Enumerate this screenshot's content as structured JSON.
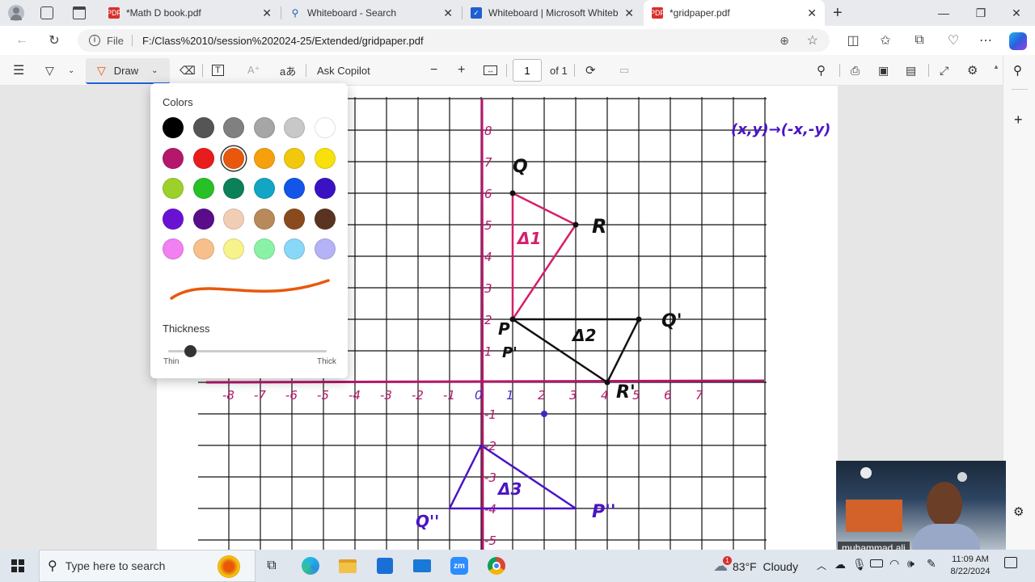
{
  "tabs": [
    {
      "title": "*Math D book.pdf",
      "icon": "pdf-icon"
    },
    {
      "title": "Whiteboard - Search",
      "icon": "search-icon"
    },
    {
      "title": "Whiteboard | Microsoft Whitebo",
      "icon": "whiteboard-icon"
    },
    {
      "title": "*gridpaper.pdf",
      "icon": "pdf-icon"
    }
  ],
  "address": {
    "prefix": "File",
    "url": "F:/Class%2010/session%202024-25/Extended/gridpaper.pdf"
  },
  "pdf_toolbar": {
    "draw_label": "Draw",
    "copilot_label": "Ask Copilot",
    "page_value": "1",
    "page_of": "of 1",
    "text_icon_label": "aあ"
  },
  "draw_popup": {
    "colors_heading": "Colors",
    "thickness_heading": "Thickness",
    "thin_label": "Thin",
    "thick_label": "Thick",
    "selected_color": "#e8580c",
    "thickness_fraction": 0.14,
    "swatches": [
      "#000000",
      "#555555",
      "#808080",
      "#a6a6a6",
      "#c8c8c8",
      "#ffffff",
      "#b5176b",
      "#e81c1c",
      "#e8580c",
      "#f5a00c",
      "#f2c80c",
      "#f7e00c",
      "#9bd12a",
      "#27c027",
      "#0c8059",
      "#12a6c4",
      "#1255e8",
      "#3a12c4",
      "#6a12d4",
      "#5a0c8a",
      "#f2cdb6",
      "#b88a5a",
      "#8a4a1e",
      "#5a3420",
      "#f280f2",
      "#f7c08a",
      "#f7f28a",
      "#8af2a6",
      "#8ad8f7",
      "#b6b2f7"
    ]
  },
  "graph": {
    "x_labels": [
      "-8",
      "-7",
      "-6",
      "-5",
      "-4",
      "-3",
      "-2",
      "-1",
      "0",
      "1",
      "2",
      "3",
      "4",
      "5",
      "6",
      "7"
    ],
    "y_pos_labels": [
      "1",
      "2",
      "3",
      "4",
      "5",
      "6",
      "7",
      "8"
    ],
    "y_neg_labels": [
      "-1",
      "-2",
      "-3",
      "-4",
      "-5"
    ],
    "rule_text": "(x,y)→(-x,-y)",
    "annotations": {
      "Q": "Q",
      "R": "R",
      "P": "P",
      "P_prime": "P'",
      "Q_prime": "Q'",
      "R_prime": "R'",
      "Q2": "Q''",
      "P2": "P''",
      "t1": "Δ1",
      "t2": "Δ2",
      "t3": "Δ3"
    }
  },
  "video": {
    "name": "muhammad ali"
  },
  "taskbar": {
    "search_placeholder": "Type here to search",
    "weather": "83°F  Cloudy",
    "time": "11:09 AM",
    "date": "8/22/2024",
    "weather_badge": "1"
  }
}
